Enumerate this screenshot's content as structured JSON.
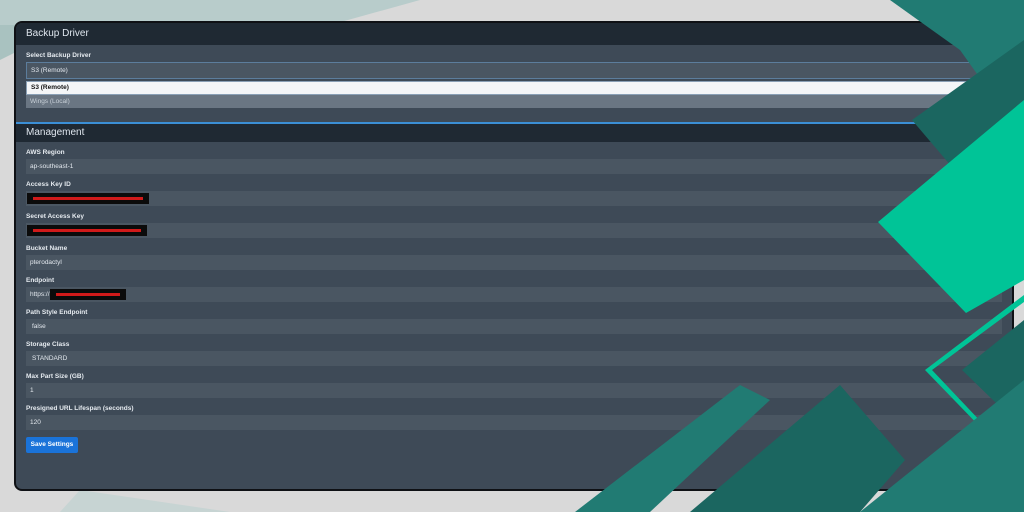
{
  "backup_driver": {
    "title": "Backup Driver",
    "select_label": "Select Backup Driver",
    "selected_value": "S3 (Remote)",
    "options": [
      "S3 (Remote)",
      "Wings (Local)"
    ]
  },
  "management": {
    "title": "Management",
    "fields": {
      "aws_region": {
        "label": "AWS Region",
        "value": "ap-southeast-1"
      },
      "access_key_id": {
        "label": "Access Key ID",
        "value": ""
      },
      "secret_access_key": {
        "label": "Secret Access Key",
        "value": ""
      },
      "bucket_name": {
        "label": "Bucket Name",
        "value": "pterodactyl"
      },
      "endpoint": {
        "label": "Endpoint",
        "value": "https://"
      },
      "path_style_endpoint": {
        "label": "Path Style Endpoint",
        "value": "false"
      },
      "storage_class": {
        "label": "Storage Class",
        "value": "STANDARD"
      },
      "max_part_size": {
        "label": "Max Part Size (GB)",
        "value": "1"
      },
      "presigned_url_lifespan": {
        "label": "Presigned URL Lifespan (seconds)",
        "value": "120"
      }
    },
    "save_label": "Save Settings"
  },
  "colors": {
    "accent": "#1a73d9",
    "panel_bg": "#3e4a57",
    "header_bg": "#1f2933",
    "field_bg": "#4a5662",
    "redaction": "#d11a1a",
    "teal_dark": "#1f6e68",
    "teal_bright": "#00c497"
  }
}
